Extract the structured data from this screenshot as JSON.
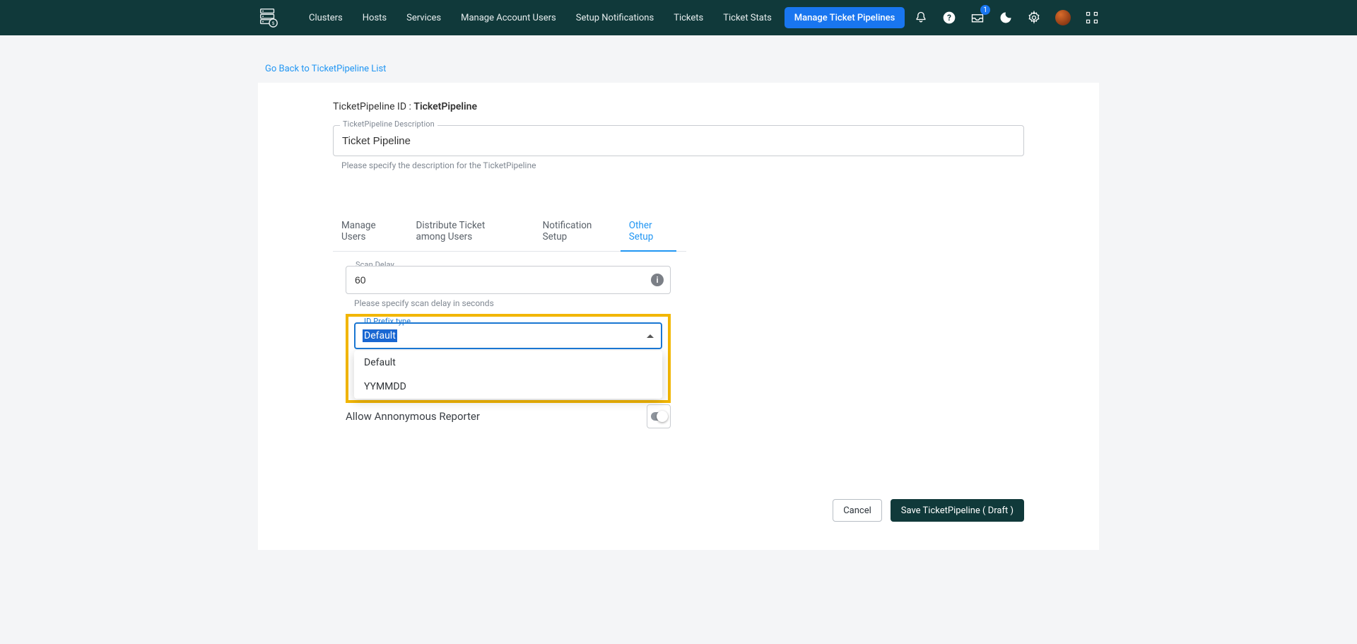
{
  "nav": {
    "items": [
      "Clusters",
      "Hosts",
      "Services",
      "Manage Account Users",
      "Setup Notifications",
      "Tickets",
      "Ticket Stats"
    ],
    "primary": "Manage Ticket Pipelines",
    "badge_count": "1"
  },
  "back_link": "Go Back to TicketPipeline List",
  "pipeline": {
    "id_label": "TicketPipeline ID : ",
    "id_value": "TicketPipeline",
    "description_label": "TicketPipeline Description",
    "description_value": "Ticket Pipeline",
    "description_helper": "Please specify the description for the TicketPipeline"
  },
  "tabs": [
    "Manage Users",
    "Distribute Ticket among Users",
    "Notification Setup",
    "Other Setup"
  ],
  "active_tab_index": 3,
  "scan": {
    "label": "Scan Delay",
    "value": "60",
    "helper": "Please specify scan delay in seconds",
    "info_glyph": "i"
  },
  "idprefix": {
    "label": "ID Prefix type",
    "selected": "Default",
    "options": [
      "Default",
      "YYMMDD"
    ]
  },
  "anon": {
    "label": "Allow Annonymous Reporter"
  },
  "footer": {
    "cancel": "Cancel",
    "save": "Save TicketPipeline ( Draft )"
  }
}
